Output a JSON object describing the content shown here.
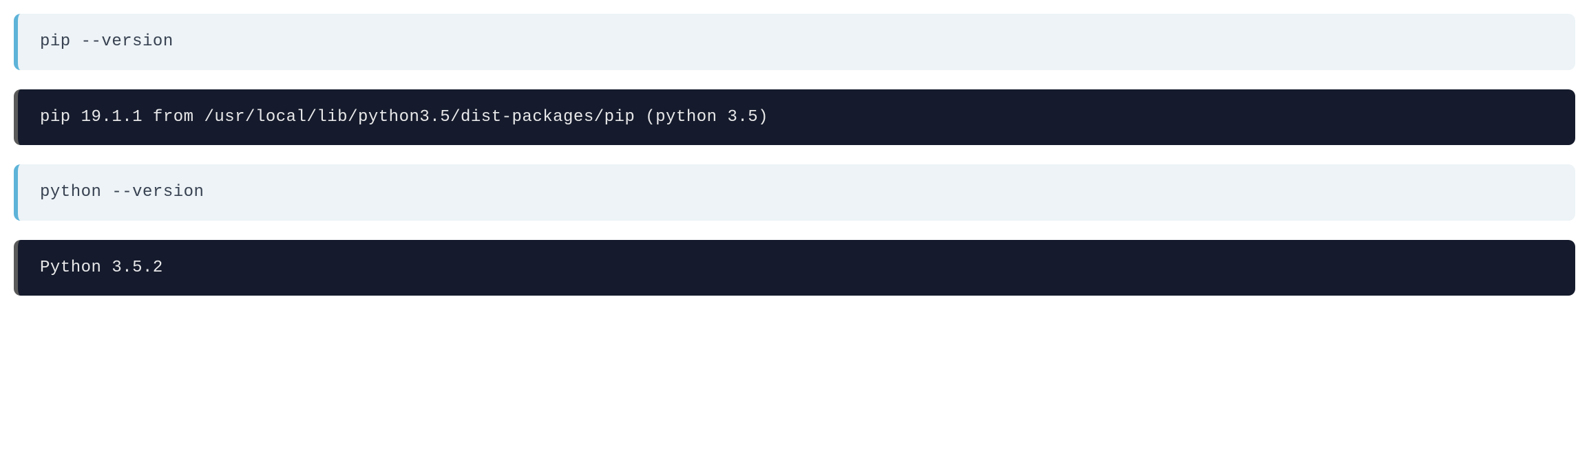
{
  "blocks": [
    {
      "type": "input",
      "text": "pip --version"
    },
    {
      "type": "output",
      "text": "pip 19.1.1 from /usr/local/lib/python3.5/dist-packages/pip (python 3.5)"
    },
    {
      "type": "input",
      "text": "python --version"
    },
    {
      "type": "output",
      "text": "Python 3.5.2"
    }
  ]
}
